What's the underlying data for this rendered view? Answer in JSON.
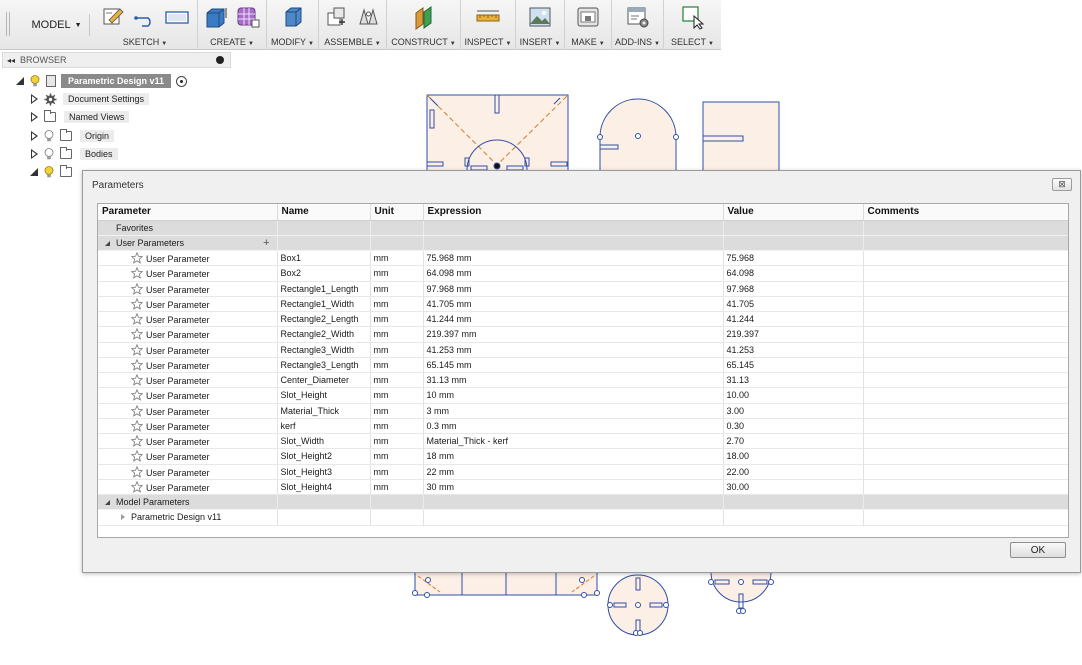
{
  "toolbar": {
    "workspace": "MODEL",
    "groups": [
      {
        "label": "SKETCH"
      },
      {
        "label": "CREATE"
      },
      {
        "label": "MODIFY"
      },
      {
        "label": "ASSEMBLE"
      },
      {
        "label": "CONSTRUCT"
      },
      {
        "label": "INSPECT"
      },
      {
        "label": "INSERT"
      },
      {
        "label": "MAKE"
      },
      {
        "label": "ADD-INS"
      },
      {
        "label": "SELECT"
      }
    ]
  },
  "browser": {
    "title": "BROWSER",
    "design_name": "Parametric Design v11",
    "items": [
      {
        "label": "Document Settings"
      },
      {
        "label": "Named Views"
      },
      {
        "label": "Origin"
      },
      {
        "label": "Bodies"
      }
    ]
  },
  "dialog": {
    "title": "Parameters",
    "ok_label": "OK",
    "columns": [
      "Parameter",
      "Name",
      "Unit",
      "Expression",
      "Value",
      "Comments"
    ],
    "favorites_label": "Favorites",
    "user_params_label": "User Parameters",
    "model_params_label": "Model Parameters",
    "model_child": "Parametric Design v11",
    "rows": [
      {
        "param": "User Parameter",
        "name": "Box1",
        "unit": "mm",
        "expression": "75.968 mm",
        "value": "75.968"
      },
      {
        "param": "User Parameter",
        "name": "Box2",
        "unit": "mm",
        "expression": "64.098 mm",
        "value": "64.098"
      },
      {
        "param": "User Parameter",
        "name": "Rectangle1_Length",
        "unit": "mm",
        "expression": "97.968 mm",
        "value": "97.968"
      },
      {
        "param": "User Parameter",
        "name": "Rectangle1_Width",
        "unit": "mm",
        "expression": "41.705 mm",
        "value": "41.705"
      },
      {
        "param": "User Parameter",
        "name": "Rectangle2_Length",
        "unit": "mm",
        "expression": "41.244 mm",
        "value": "41.244"
      },
      {
        "param": "User Parameter",
        "name": "Rectangle2_Width",
        "unit": "mm",
        "expression": "219.397 mm",
        "value": "219.397"
      },
      {
        "param": "User Parameter",
        "name": "Rectangle3_Width",
        "unit": "mm",
        "expression": "41.253 mm",
        "value": "41.253"
      },
      {
        "param": "User Parameter",
        "name": "Rectangle3_Length",
        "unit": "mm",
        "expression": "65.145 mm",
        "value": "65.145"
      },
      {
        "param": "User Parameter",
        "name": "Center_Diameter",
        "unit": "mm",
        "expression": "31.13 mm",
        "value": "31.13"
      },
      {
        "param": "User Parameter",
        "name": "Slot_Height",
        "unit": "mm",
        "expression": "10 mm",
        "value": "10.00"
      },
      {
        "param": "User Parameter",
        "name": "Material_Thick",
        "unit": "mm",
        "expression": "3 mm",
        "value": "3.00"
      },
      {
        "param": "User Parameter",
        "name": "kerf",
        "unit": "mm",
        "expression": "0.3 mm",
        "value": "0.30"
      },
      {
        "param": "User Parameter",
        "name": "Slot_Width",
        "unit": "mm",
        "expression": "Material_Thick - kerf",
        "value": "2.70"
      },
      {
        "param": "User Parameter",
        "name": "Slot_Height2",
        "unit": "mm",
        "expression": "18 mm",
        "value": "18.00"
      },
      {
        "param": "User Parameter",
        "name": "Slot_Height3",
        "unit": "mm",
        "expression": "22 mm",
        "value": "22.00"
      },
      {
        "param": "User Parameter",
        "name": "Slot_Height4",
        "unit": "mm",
        "expression": "30 mm",
        "value": "30.00"
      }
    ]
  }
}
